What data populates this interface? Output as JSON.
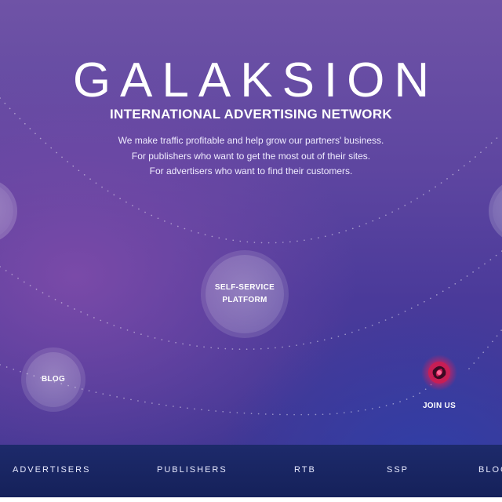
{
  "header": {
    "brand": "GALAKSION",
    "subtitle": "INTERNATIONAL ADVERTISING NETWORK",
    "tagline": [
      "We make traffic profitable and help grow our partners' business.",
      "For publishers who want to get the most out of their sites.",
      "For advertisers who want to find their customers."
    ]
  },
  "bubbles": {
    "self_service_line1": "SELF-SERVICE",
    "self_service_line2": "PLATFORM",
    "blog": "BLOG"
  },
  "join": {
    "label": "JOIN US",
    "icon": "swirl-logo-icon"
  },
  "nav": {
    "items": [
      "ADVERTISERS",
      "PUBLISHERS",
      "RTB",
      "SSP",
      "BLOG"
    ]
  },
  "colors": {
    "nav_background": "#1a2560",
    "join_icon_accent": "#e0245e",
    "glow_blue": "#2aa8e0"
  }
}
